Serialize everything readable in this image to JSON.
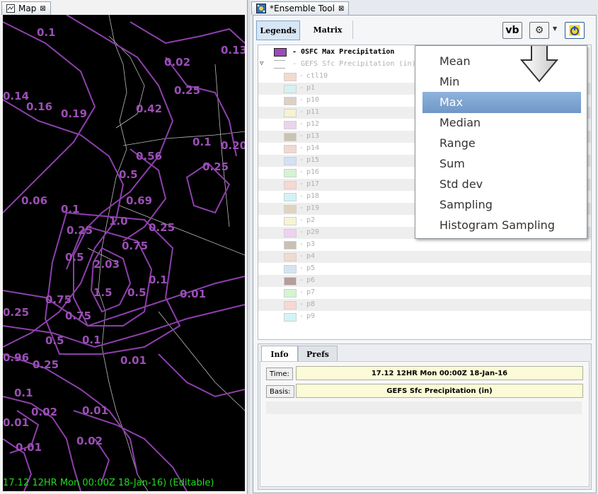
{
  "map": {
    "tab_label": "Map",
    "status": "17.12  12HR Mon 00:00Z 18-Jan-16)  (Editable)",
    "labels": [
      "0.1",
      "0.13",
      "0.02",
      "0.14",
      "0.25",
      "0.16",
      "0.19",
      "0.42",
      "0.1",
      "0.20",
      "0.56",
      "0.25",
      "0.06",
      "0.5",
      "0.1",
      "0.69",
      "0.25",
      "1.0",
      "0.25",
      "0.5",
      "0.75",
      "2.03",
      "0.1",
      "1.5",
      "0.5",
      "0.75",
      "0.01",
      "0.25",
      "0.75",
      "0.96",
      "0.5",
      "0.1",
      "0.25",
      "0.01",
      "0.1",
      "0.02",
      "0.01",
      "0.01",
      "0.02",
      "0.01"
    ]
  },
  "ensemble": {
    "tab_label": "*Ensemble Tool",
    "tabs": [
      "Legends",
      "Matrix"
    ],
    "vb_label": "vb",
    "legend_top": "0SFC Max Precipitation",
    "legend_group": "GEFS Sfc Precipitation (in)",
    "members": [
      "ctl10",
      "p1",
      "p10",
      "p11",
      "p12",
      "p13",
      "p14",
      "p15",
      "p16",
      "p17",
      "p18",
      "p19",
      "p2",
      "p20",
      "p3",
      "p4",
      "p5",
      "p6",
      "p7",
      "p8",
      "p9"
    ],
    "member_colors": [
      "#f4d9cf",
      "#d4f2f3",
      "#ded0c4",
      "#f6f3cf",
      "#ecd3ee",
      "#cbc3b2",
      "#f3d7d2",
      "#d3e1f3",
      "#d4f4d2",
      "#f8d8d1",
      "#d0f4f6",
      "#e1d3c2",
      "#f7f4d4",
      "#efd2f1",
      "#c9c2b2",
      "#f1dad1",
      "#d5e4f3",
      "#b49d9a",
      "#d4f4d2",
      "#f7d9d1",
      "#d3f4f6"
    ],
    "bottom_tabs": [
      "Info",
      "Prefs"
    ],
    "time_label": "Time:",
    "time_value": "17.12  12HR Mon 00:00Z 18-Jan-16",
    "basis_label": "Basis:",
    "basis_value": "GEFS Sfc Precipitation (in)",
    "menu": [
      "Mean",
      "Min",
      "Max",
      "Median",
      "Range",
      "Sum",
      "Std dev",
      "Sampling",
      "Histogram Sampling"
    ],
    "menu_selected": "Max"
  },
  "icons": [
    "map-icon",
    "ensemble-icon",
    "close-icon",
    "gear-icon",
    "chevron-down-icon",
    "power-icon",
    "down-arrow-icon",
    "collapse-icon"
  ]
}
